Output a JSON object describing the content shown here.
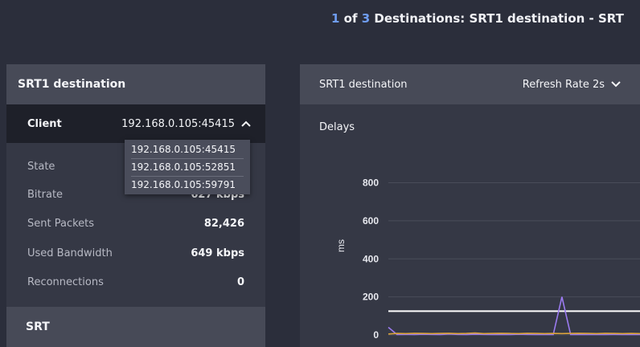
{
  "header": {
    "current": "1",
    "of_word": " of ",
    "total": "3",
    "title_suffix": " Destinations: SRT1 destination - SRT"
  },
  "left_panel": {
    "title": "SRT1 destination",
    "client_label": "Client",
    "client_value": "192.168.0.105:45415",
    "stats": [
      {
        "label": "State",
        "value": ""
      },
      {
        "label": "Bitrate",
        "value": "627 kbps"
      },
      {
        "label": "Sent Packets",
        "value": "82,426"
      },
      {
        "label": "Used Bandwidth",
        "value": "649 kbps"
      },
      {
        "label": "Reconnections",
        "value": "0"
      }
    ],
    "section_title": "SRT"
  },
  "client_dropdown": {
    "options": [
      "192.168.0.105:45415",
      "192.168.0.105:52851",
      "192.168.0.105:59791"
    ]
  },
  "right_panel": {
    "title": "SRT1 destination",
    "refresh_label": "Refresh Rate 2s",
    "subtitle": "Delays"
  },
  "colors": {
    "accent": "#6f9df2",
    "series_purple": "#9b7bf0",
    "series_orange": "#d9a23c",
    "threshold_line": "#ffffff"
  },
  "chart_data": {
    "type": "line",
    "title": "Delays",
    "ylabel": "ms",
    "xlabel": "",
    "ylim": [
      0,
      950
    ],
    "yticks": [
      "0",
      "200",
      "400",
      "600",
      "800"
    ],
    "threshold": 125,
    "series": [
      {
        "values": [
          40,
          2,
          3,
          2,
          4,
          3,
          2,
          5,
          3,
          2,
          4,
          3,
          2,
          3,
          2,
          4,
          3,
          2,
          3,
          2,
          200,
          2,
          3,
          2,
          3,
          2,
          3,
          2,
          3,
          2
        ]
      },
      {
        "values": [
          5,
          8,
          7,
          9,
          8,
          7,
          8,
          9,
          7,
          8,
          10,
          7,
          8,
          9,
          8,
          7,
          9,
          8,
          7,
          8,
          7,
          8,
          9,
          8,
          7,
          9,
          8,
          7,
          8,
          7
        ]
      }
    ]
  }
}
